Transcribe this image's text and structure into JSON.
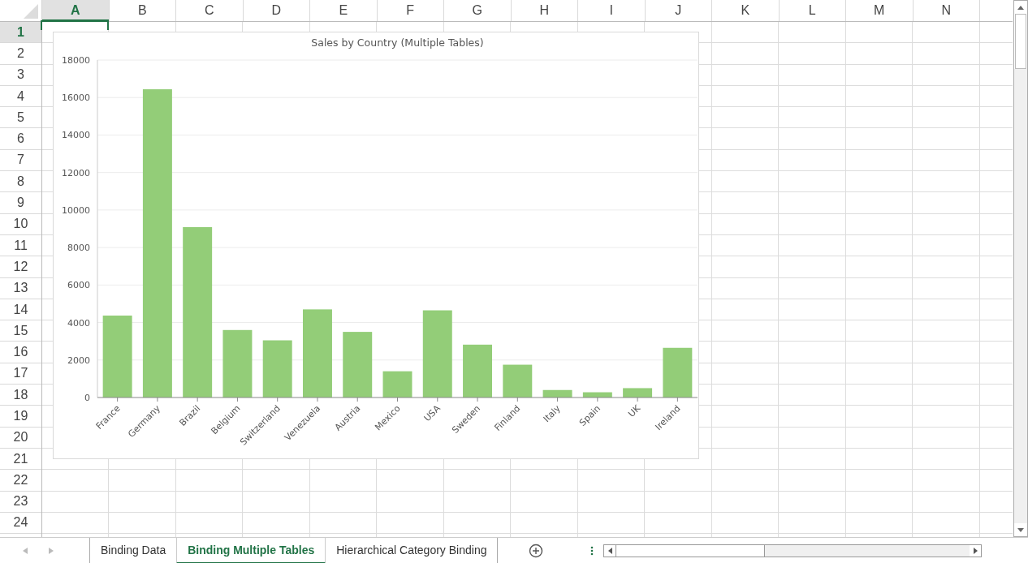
{
  "columns": [
    {
      "label": "A",
      "selected": true
    },
    {
      "label": "B",
      "selected": false
    },
    {
      "label": "C",
      "selected": false
    },
    {
      "label": "D",
      "selected": false
    },
    {
      "label": "E",
      "selected": false
    },
    {
      "label": "F",
      "selected": false
    },
    {
      "label": "G",
      "selected": false
    },
    {
      "label": "H",
      "selected": false
    },
    {
      "label": "I",
      "selected": false
    },
    {
      "label": "J",
      "selected": false
    },
    {
      "label": "K",
      "selected": false
    },
    {
      "label": "L",
      "selected": false
    },
    {
      "label": "M",
      "selected": false
    },
    {
      "label": "N",
      "selected": false
    }
  ],
  "rows": [
    {
      "label": "1",
      "selected": true
    },
    {
      "label": "2",
      "selected": false
    },
    {
      "label": "3",
      "selected": false
    },
    {
      "label": "4",
      "selected": false
    },
    {
      "label": "5",
      "selected": false
    },
    {
      "label": "6",
      "selected": false
    },
    {
      "label": "7",
      "selected": false
    },
    {
      "label": "8",
      "selected": false
    },
    {
      "label": "9",
      "selected": false
    },
    {
      "label": "10",
      "selected": false
    },
    {
      "label": "11",
      "selected": false
    },
    {
      "label": "12",
      "selected": false
    },
    {
      "label": "13",
      "selected": false
    },
    {
      "label": "14",
      "selected": false
    },
    {
      "label": "15",
      "selected": false
    },
    {
      "label": "16",
      "selected": false
    },
    {
      "label": "17",
      "selected": false
    },
    {
      "label": "18",
      "selected": false
    },
    {
      "label": "19",
      "selected": false
    },
    {
      "label": "20",
      "selected": false
    },
    {
      "label": "21",
      "selected": false
    },
    {
      "label": "22",
      "selected": false
    },
    {
      "label": "23",
      "selected": false
    },
    {
      "label": "24",
      "selected": false
    }
  ],
  "chart": {
    "chart_data": {
      "type": "bar",
      "title": "Sales by Country (Multiple Tables)",
      "categories": [
        "France",
        "Germany",
        "Brazil",
        "Belgium",
        "Switzerland",
        "Venezuela",
        "Austria",
        "Mexico",
        "USA",
        "Sweden",
        "Finland",
        "Italy",
        "Spain",
        "UK",
        "Ireland"
      ],
      "grid": true,
      "series": [
        {
          "color": "#93cd78",
          "values": [
            4370,
            16440,
            9090,
            3600,
            3050,
            4700,
            3500,
            1400,
            4650,
            2820,
            1750,
            400,
            280,
            500,
            2650
          ]
        }
      ],
      "ylim": [
        0,
        18000
      ],
      "yticks": [
        0,
        2000,
        4000,
        6000,
        8000,
        10000,
        12000,
        14000,
        16000,
        18000
      ]
    }
  },
  "sheet_tabs": [
    {
      "label": "Binding Data",
      "selected": false
    },
    {
      "label": "Binding Multiple Tables",
      "selected": true
    },
    {
      "label": "Hierarchical Category Binding",
      "selected": false
    }
  ]
}
